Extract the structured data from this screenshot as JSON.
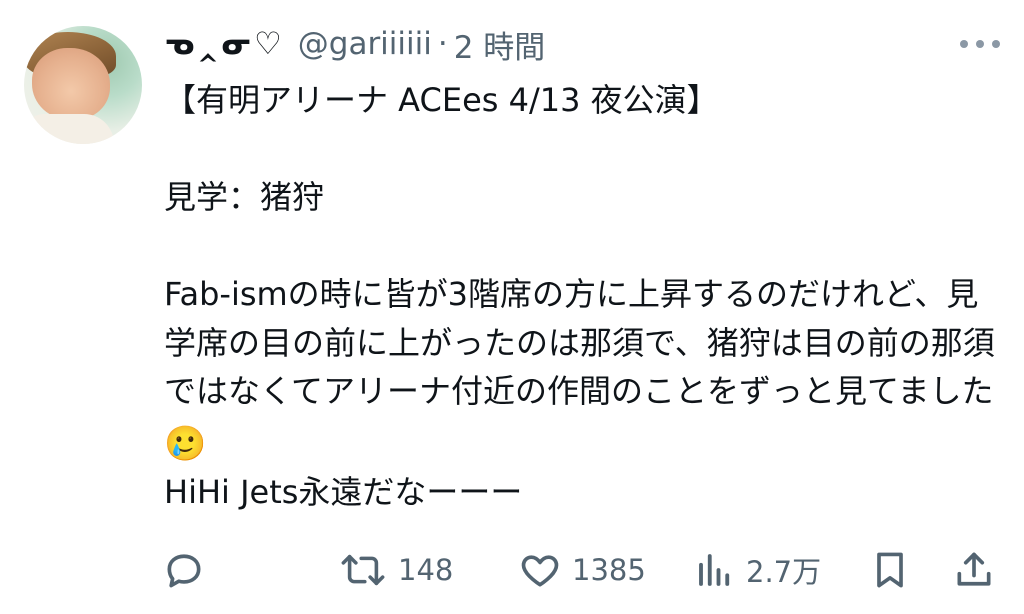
{
  "post": {
    "display_name": "ᓀ‸ᓂ♡",
    "handle": "@gariiiiii",
    "separator": "·",
    "time": "2 時間",
    "body": "【有明アリーナ ACEes 4/13 夜公演】\n\n見学：猪狩\n\nFab-ismの時に皆が3階席の方に上昇するのだけれど、見学席の目の前に上がったのは那須で、猪狩は目の前の那須ではなくてアリーナ付近の作間のことをずっと見てました",
    "emoji": "🥲",
    "body_tail": "\nHiHi Jets永遠だなーーー"
  },
  "actions": {
    "reply_label": "",
    "retweet_count": "148",
    "like_count": "1385",
    "views_count": "2.7万",
    "bookmark_label": "",
    "share_label": ""
  },
  "icons": {
    "avatar": "user-avatar",
    "more": "more-icon",
    "reply": "reply-icon",
    "retweet": "retweet-icon",
    "like": "heart-icon",
    "views": "views-icon",
    "bookmark": "bookmark-icon",
    "share": "share-icon"
  },
  "colors": {
    "text_primary": "#0f1419",
    "text_secondary": "#536471",
    "icon_gray": "#8b98a5"
  }
}
